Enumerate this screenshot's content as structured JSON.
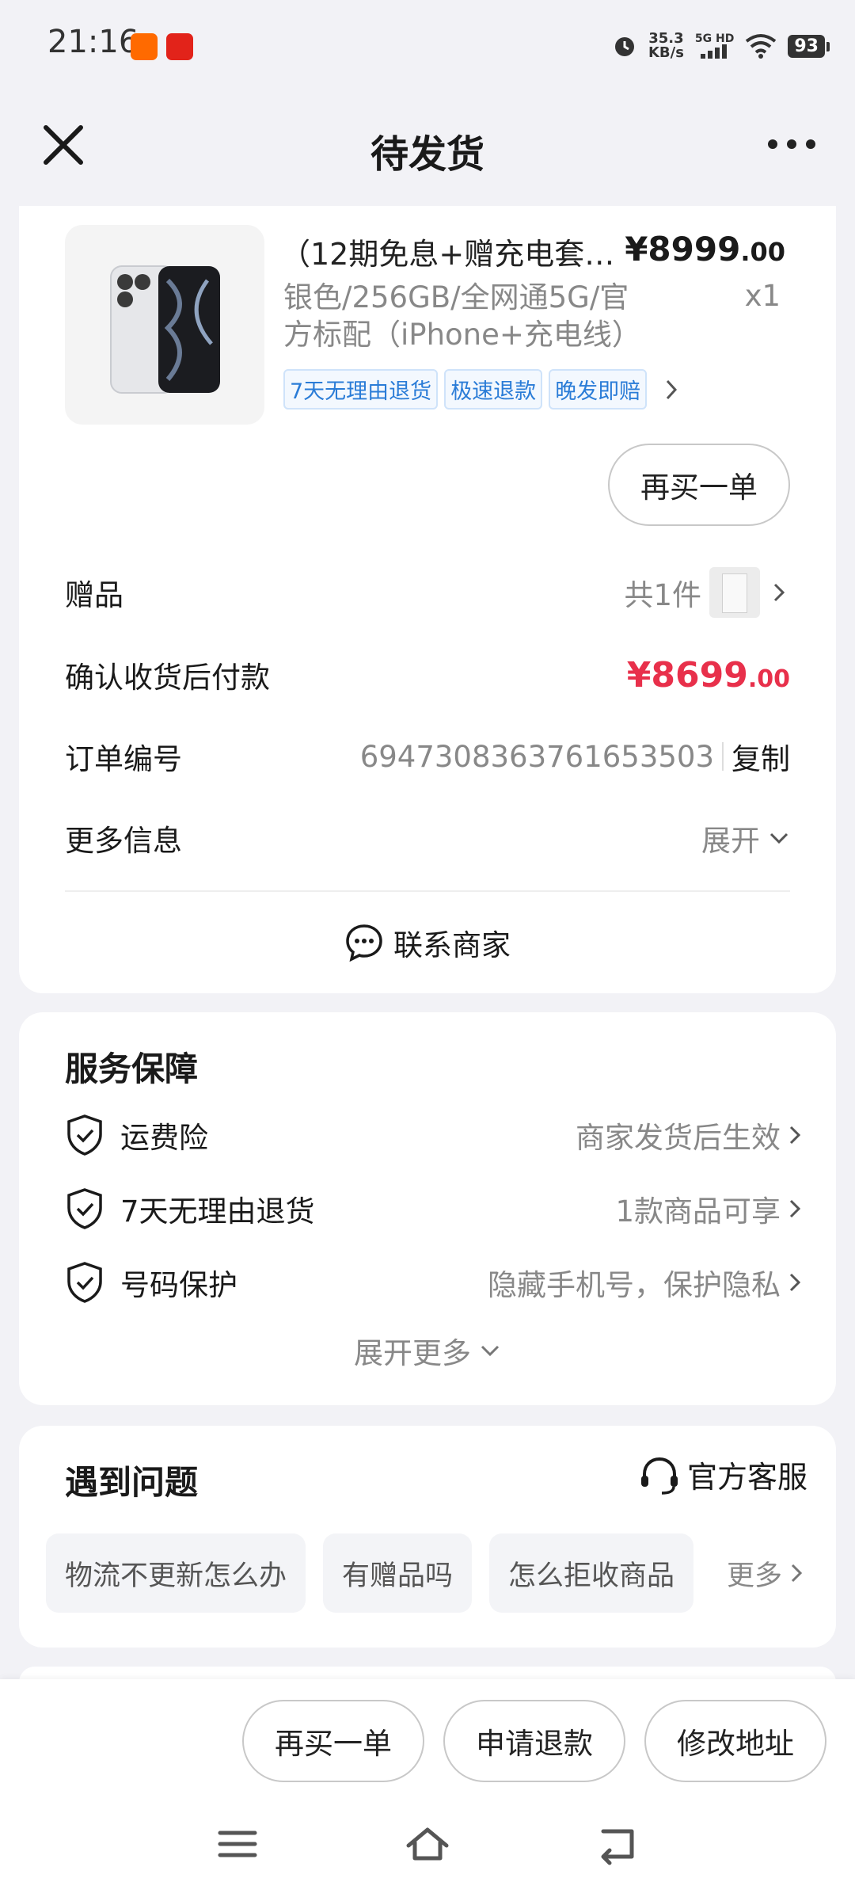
{
  "status_bar": {
    "time": "21:16",
    "speed_value": "35.3",
    "speed_unit": "KB/s",
    "network": "5G",
    "network_hd": "HD",
    "battery": "93"
  },
  "header": {
    "title": "待发货",
    "close_icon": "close-icon",
    "more_icon": "more-dots-icon"
  },
  "product": {
    "title": "（12期免息+赠充电套…",
    "price_int": "¥8999",
    "price_dec": ".00",
    "sku_line1": "银色/256GB/全网通5G/官",
    "sku_line2": "方标配（iPhone+充电线）",
    "qty": "x1",
    "tags": [
      "7天无理由退货",
      "极速退款",
      "晚发即赔"
    ],
    "rebuy_label": "再买一单"
  },
  "details": {
    "gift_label": "赠品",
    "gift_value": "共1件",
    "pay_label": "确认收货后付款",
    "pay_int": "¥8699",
    "pay_dec": ".00",
    "order_label": "订单编号",
    "order_number": "6947308363761653503",
    "copy_label": "复制",
    "more_label": "更多信息",
    "expand_label": "展开",
    "contact_label": "联系商家"
  },
  "service": {
    "title": "服务保障",
    "items": [
      {
        "label": "运费险",
        "value": "商家发货后生效"
      },
      {
        "label": "7天无理由退货",
        "value": "1款商品可享"
      },
      {
        "label": "号码保护",
        "value": "隐藏手机号，保护隐私"
      }
    ],
    "expand_more": "展开更多"
  },
  "problems": {
    "title": "遇到问题",
    "cs_label": "官方客服",
    "chips": [
      "物流不更新怎么办",
      "有赠品吗",
      "怎么拒收商品"
    ],
    "more_label": "更多"
  },
  "bottom_actions": {
    "rebuy": "再买一单",
    "refund": "申请退款",
    "change_address": "修改地址"
  },
  "colors": {
    "accent_red": "#e8304b",
    "tag_blue": "#2a7cd7",
    "background": "#f2f2f6"
  }
}
